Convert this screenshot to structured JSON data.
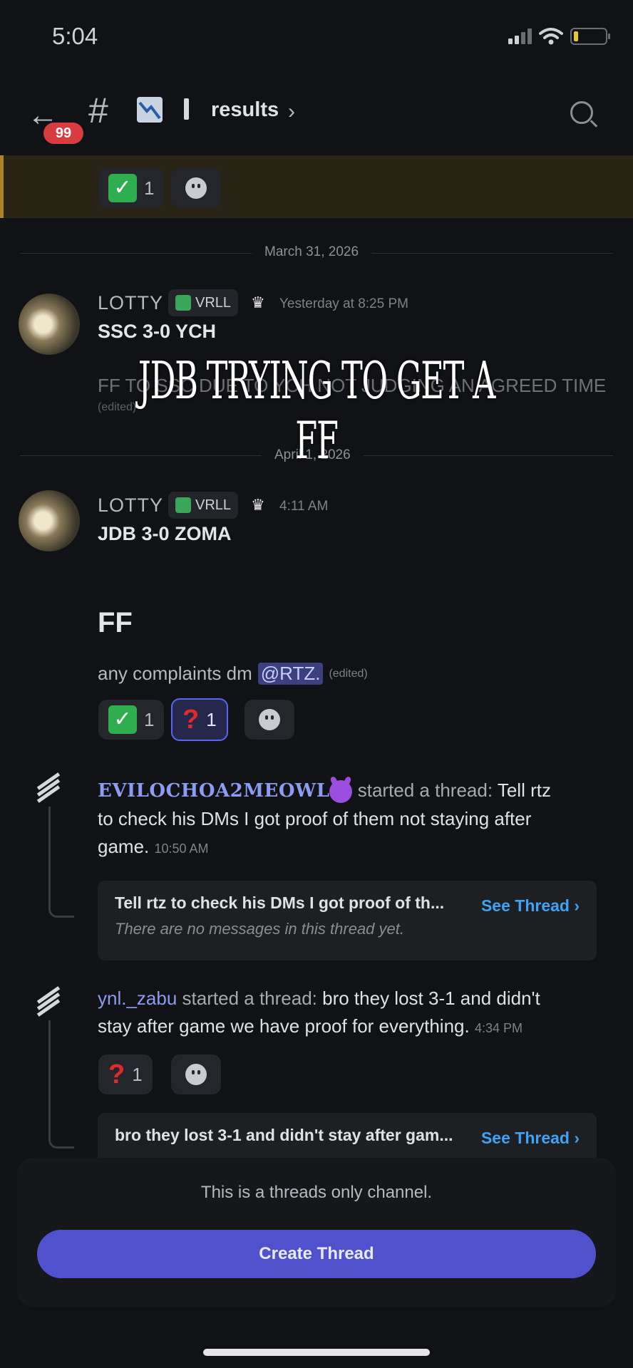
{
  "status_bar": {
    "time": "5:04"
  },
  "header": {
    "unread_count": "99",
    "channel_name": "results"
  },
  "top_strip": {
    "check_count": "1"
  },
  "messages": [
    {
      "date_divider": "March 31, 2026",
      "author": "LOTTY",
      "role_tag": "VRLL",
      "timestamp": "Yesterday at 8:25 PM",
      "headline": "SSC 3-0 YCH",
      "body_faded": "FF TO SSC DUE TO YCH NOT JUDGING AN AGREED TIME",
      "edited": "(edited)"
    },
    {
      "date_divider": "April 1, 2026",
      "author": "LOTTY",
      "role_tag": "VRLL",
      "timestamp": "4:11 AM",
      "headline": "JDB 3-0 ZOMA",
      "heading": "FF",
      "body_prefix": "any complaints dm",
      "mention": "@RTZ.",
      "edited": "(edited)",
      "reactions": [
        {
          "icon": "check-mark",
          "count": "1"
        },
        {
          "icon": "question-mark",
          "count": "1"
        }
      ]
    }
  ],
  "overlay_caption": "JDB TRYING TO GET A FF",
  "threads": [
    {
      "user": "EVILOCHOA2MEOWL",
      "action": "started a thread:",
      "text_line1": "Tell rtz",
      "text_line2": "to check his DMs I got proof of them not staying after",
      "text_line3": "game.",
      "timestamp": "10:50 AM",
      "card_title": "Tell rtz to check his DMs I got proof of th...",
      "card_subtitle": "There are no messages in this thread yet.",
      "see_thread": "See Thread ›"
    },
    {
      "user": "ynl._zabu",
      "action": "started a thread:",
      "text_line1": "bro they lost 3-1 and didn't",
      "text_line2": "stay after game we have proof for everything.",
      "timestamp": "4:34 PM",
      "reaction_count": "1",
      "card_title": "bro they lost 3-1 and didn't stay after gam...",
      "see_thread": "See Thread ›"
    }
  ],
  "composer": {
    "notice": "This is a threads only channel.",
    "button": "Create Thread"
  },
  "colors": {
    "background": "#111215",
    "accent": "#5865f2",
    "link": "#3ea3f5",
    "button": "#4f52cc",
    "highlight": "#2a2416"
  }
}
